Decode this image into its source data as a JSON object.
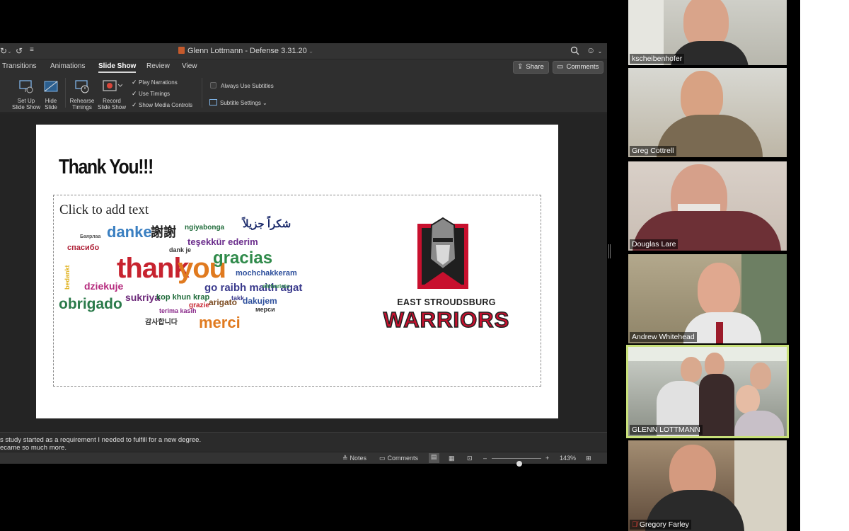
{
  "app": {
    "document_title": "Glenn Lottmann - Defense 3.31.20"
  },
  "tabs": [
    {
      "label": "Transitions",
      "active": false
    },
    {
      "label": "Animations",
      "active": false
    },
    {
      "label": "Slide Show",
      "active": true
    },
    {
      "label": "Review",
      "active": false
    },
    {
      "label": "View",
      "active": false
    }
  ],
  "top_buttons": {
    "share": "Share",
    "comments": "Comments"
  },
  "ribbon": {
    "set_up_line1": "Set Up",
    "set_up_line2": "Slide Show",
    "hide_line1": "Hide",
    "hide_line2": "Slide",
    "rehearse_line1": "Rehearse",
    "rehearse_line2": "Timings",
    "record_line1": "Record",
    "record_line2": "Slide Show",
    "play_narrations": "Play Narrations",
    "use_timings": "Use Timings",
    "show_media_controls": "Show Media Controls",
    "always_use_subtitles": "Always Use Subtitles",
    "subtitle_settings": "Subtitle Settings"
  },
  "slide": {
    "title": "Thank You!!!",
    "placeholder": "Click to add text",
    "logo_line1": "EAST STROUDSBURG",
    "logo_line2": "WARRIORS",
    "wordcloud": [
      "danke",
      "謝謝",
      "ngiyabonga",
      "شكراً جزيلاً",
      "спасибо",
      "teşekkür ederim",
      "dank je",
      "thank",
      "you",
      "gracias",
      "mochchakkeram",
      "dziekuje",
      "go raibh maith agat",
      "sukriya",
      "kop khun krap",
      "obrigado",
      "grazie",
      "arigato",
      "dakujem",
      "мерси",
      "terima kasih",
      "감사합니다",
      "merci",
      "Баярлаа",
      "bedankt",
      "takk",
      "efcharisto"
    ]
  },
  "notes": {
    "line1": "s study started as a requirement I needed to fulfill for a new degree.",
    "line2": "ecame so much more."
  },
  "status": {
    "notes": "Notes",
    "comments": "Comments",
    "zoom": "143%",
    "zoom_minus": "–",
    "zoom_plus": "+"
  },
  "participants": [
    {
      "name": "kscheibenhofer",
      "muted": false,
      "speaking": false
    },
    {
      "name": "Greg Cottrell",
      "muted": false,
      "speaking": false
    },
    {
      "name": "Douglas Lare",
      "muted": false,
      "speaking": false
    },
    {
      "name": "Andrew Whitehead",
      "muted": false,
      "speaking": false
    },
    {
      "name": "GLENN LOTTMANN",
      "muted": false,
      "speaking": true
    },
    {
      "name": "Gregory Farley",
      "muted": true,
      "speaking": false
    }
  ],
  "colors": {
    "accent_active_speaker": "#c8e07a",
    "logo_red": "#c8102e"
  }
}
